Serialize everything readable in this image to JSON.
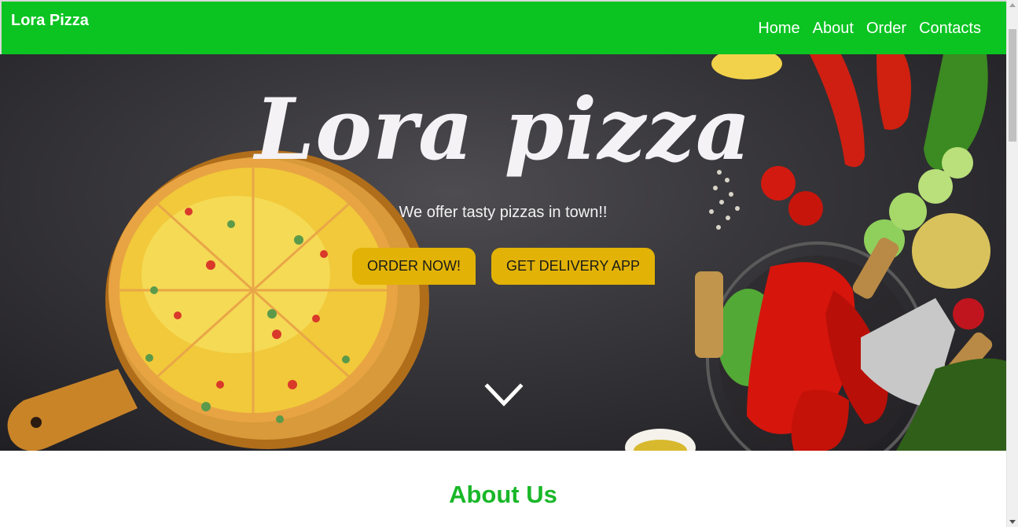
{
  "header": {
    "brand": "Lora Pizza",
    "nav": [
      "Home",
      "About",
      "Order",
      "Contacts"
    ]
  },
  "hero": {
    "title": "Lora pizza",
    "subtitle": "We offer tasty pizzas in town!!",
    "buttons": {
      "order": "ORDER NOW!",
      "app": "GET DELIVERY APP"
    }
  },
  "about": {
    "title": "About Us"
  },
  "colors": {
    "header_bg": "#0bc422",
    "button_bg": "#e2b306",
    "about_title": "#19b728"
  },
  "icons": {
    "scroll_down": "chevron-down-icon"
  }
}
